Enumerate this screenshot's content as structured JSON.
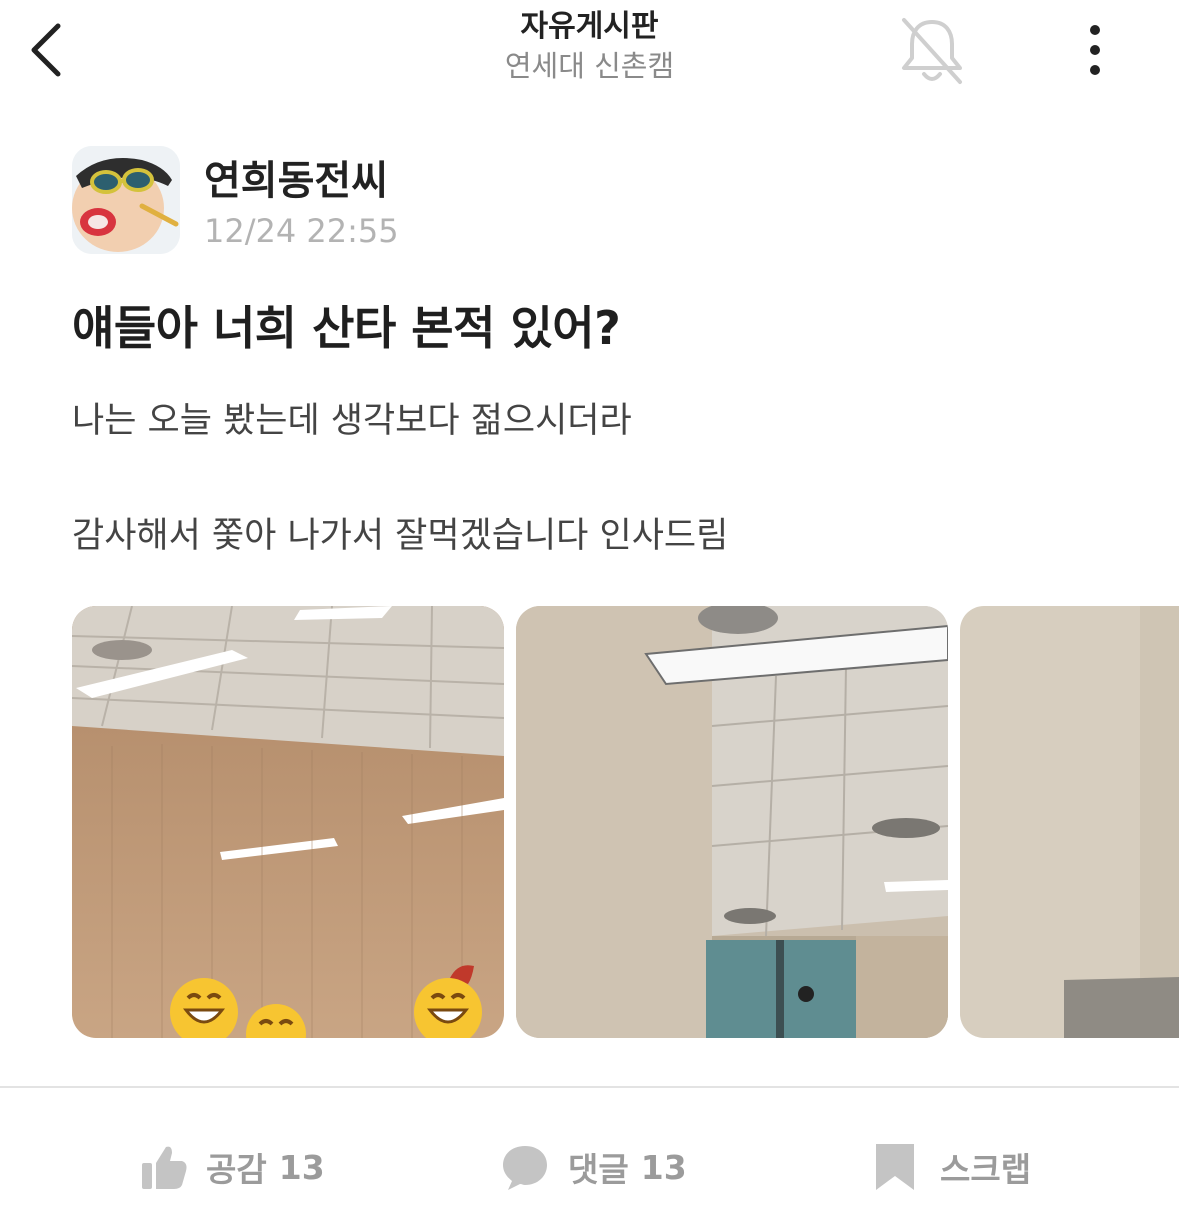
{
  "header": {
    "title": "자유게시판",
    "subtitle": "연세대 신촌캠"
  },
  "post": {
    "author": "연희동전씨",
    "time": "12/24 22:55",
    "title": "얘들아 너희 산타 본적 있어?",
    "body_lines": [
      "나는 오늘 봤는데 생각보다 젊으시더라",
      "감사해서 쫓아 나가서 잘먹겠습니다 인사드림"
    ]
  },
  "actions": {
    "like_label": "공감",
    "like_count": "13",
    "comment_label": "댓글",
    "comment_count": "13",
    "scrap_label": "스크랩"
  },
  "colors": {
    "icon_gray": "#c4c4c4",
    "action_gray": "#9b9b9b",
    "time_gray": "#b3b3b3"
  },
  "icons": [
    "back-arrow-icon",
    "bell-off-icon",
    "more-vertical-icon",
    "thumbs-up-icon",
    "comment-bubble-icon",
    "bookmark-icon"
  ]
}
